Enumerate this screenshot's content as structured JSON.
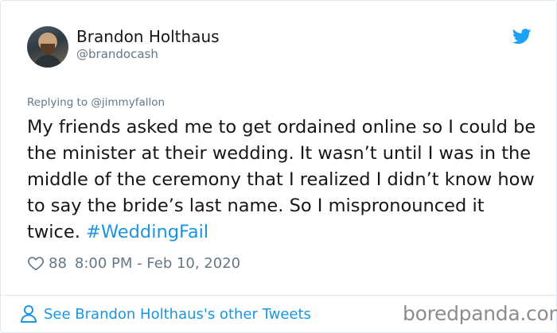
{
  "author": {
    "display_name": "Brandon Holthaus",
    "handle": "@brandocash",
    "avatar_icon": "profile-photo"
  },
  "reply": {
    "prefix": "Replying to ",
    "mention": "@jimmyfallon"
  },
  "tweet": {
    "text": "My friends asked me to get ordained online so I could be the minister at their wedding. It wasn’t until I was in the middle of the ceremony that I realized I didn’t know how to say the bride’s last name. So I mispronounced it twice. ",
    "hashtag": "#WeddingFail"
  },
  "meta": {
    "like_icon": "heart-icon",
    "likes": "88",
    "timestamp": "8:00 PM - Feb 10, 2020"
  },
  "footer": {
    "link_icon": "person-icon",
    "link_text": "See Brandon Holthaus's other Tweets"
  },
  "watermark": "boredpanda.com",
  "colors": {
    "link": "#1b95e0",
    "secondary_text": "#657786",
    "primary_text": "#14171a",
    "twitter_blue": "#1da1f2",
    "border": "#e1e8ed"
  }
}
